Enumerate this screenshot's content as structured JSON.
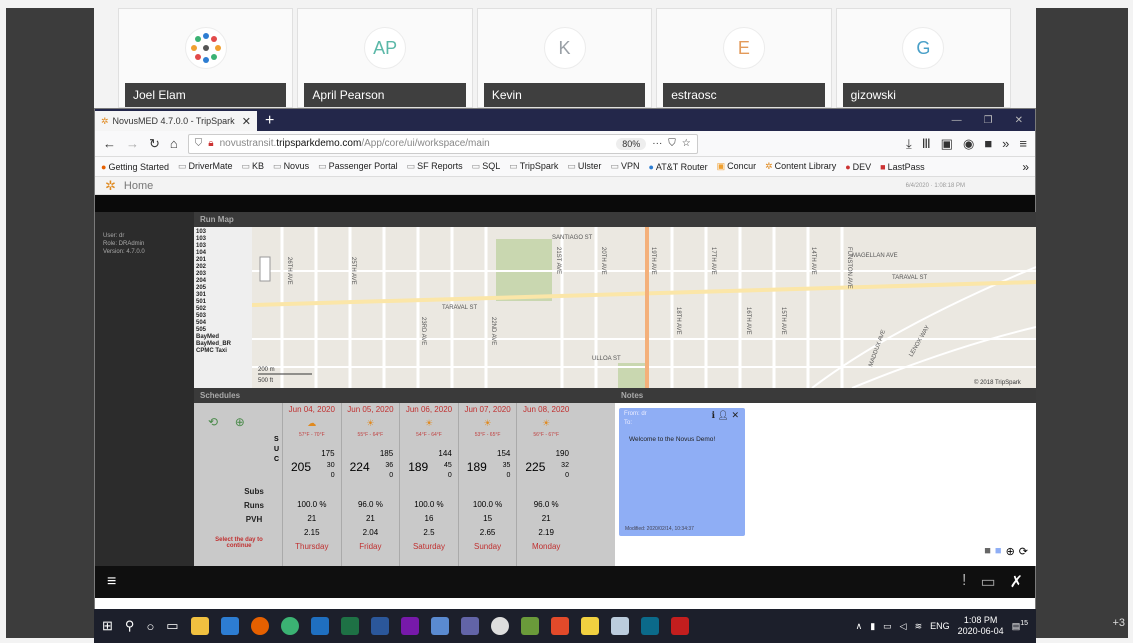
{
  "participants": [
    {
      "name": "Joel Elam",
      "initials": ""
    },
    {
      "name": "April Pearson",
      "initials": "AP",
      "color": "#5bb8a8"
    },
    {
      "name": "Kevin",
      "initials": "K",
      "color": "#9aa0a6"
    },
    {
      "name": "estraosc",
      "initials": "E",
      "color": "#e39a5a"
    },
    {
      "name": "gizowski",
      "initials": "G",
      "color": "#4aa0c8"
    }
  ],
  "extra_participants": "+3",
  "browser": {
    "tab_title": "NovusMED 4.7.0.0 - TripSpark",
    "url_prefix": "novustransit.",
    "url_domain": "tripsparkdemo.com",
    "url_path": "/App/core/ui/workspace/main",
    "zoom": "80%",
    "bookmarks": [
      "Getting Started",
      "DriverMate",
      "KB",
      "Novus",
      "Passenger Portal",
      "SF Reports",
      "SQL",
      "TripSpark",
      "Ulster",
      "VPN",
      "AT&T Router",
      "Concur",
      "Content Library",
      "DEV",
      "LastPass"
    ]
  },
  "app": {
    "home_label": "Home",
    "header_datetime": "6/4/2020 · 1:08:18 PM",
    "user_info": {
      "user": "User:   dr",
      "role": "Role:   DRAdmin",
      "version": "Version:  4.7.0.0"
    },
    "run_map": {
      "title": "Run Map",
      "runs": [
        "103",
        "103",
        "103",
        "104",
        "201",
        "202",
        "203",
        "204",
        "205",
        "301",
        "501",
        "502",
        "503",
        "504",
        "505",
        "BayMed",
        "BayMed_BR",
        "CPMC Taxi"
      ],
      "streets": [
        "SANTIAGO ST",
        "TARAVAL ST",
        "ULLOA ST",
        "MAGELLAN AVE",
        "TARAVAL ST",
        "26TH AVE",
        "25TH AVE",
        "23RD AVE",
        "22ND AVE",
        "21ST AVE",
        "20TH AVE",
        "19TH AVE",
        "18TH AVE",
        "17TH AVE",
        "16TH AVE",
        "15TH AVE",
        "14TH AVE",
        "FUNSTON AVE",
        "LENOX WAY",
        "MADDUX AVE"
      ],
      "scale_m": "200 m",
      "scale_ft": "500 ft",
      "attribution": "© 2018 TripSpark"
    },
    "schedules": {
      "title": "Schedules",
      "select_hint": "Select the day to continue",
      "row_labels": {
        "subs": "Subs",
        "runs": "Runs",
        "pvh": "PVH"
      },
      "suc_labels": [
        "S",
        "U",
        "C"
      ],
      "days": [
        {
          "date": "Jun 04, 2020",
          "temp": "57°F - 70°F",
          "s": "175",
          "total": "205",
          "u": "30",
          "c": "0",
          "subs": "100.0  %",
          "runs": "21",
          "pvh": "2.15",
          "dow": "Thursday"
        },
        {
          "date": "Jun 05, 2020",
          "temp": "55°F - 64°F",
          "s": "185",
          "total": "224",
          "u": "36",
          "c": "0",
          "subs": "96.0  %",
          "runs": "21",
          "pvh": "2.04",
          "dow": "Friday"
        },
        {
          "date": "Jun 06, 2020",
          "temp": "54°F - 64°F",
          "s": "144",
          "total": "189",
          "u": "45",
          "c": "0",
          "subs": "100.0  %",
          "runs": "16",
          "pvh": "2.5",
          "dow": "Saturday"
        },
        {
          "date": "Jun 07, 2020",
          "temp": "53°F - 65°F",
          "s": "154",
          "total": "189",
          "u": "35",
          "c": "0",
          "subs": "100.0  %",
          "runs": "15",
          "pvh": "2.65",
          "dow": "Sunday"
        },
        {
          "date": "Jun 08, 2020",
          "temp": "56°F - 67°F",
          "s": "190",
          "total": "225",
          "u": "32",
          "c": "0",
          "subs": "96.0  %",
          "runs": "21",
          "pvh": "2.19",
          "dow": "Monday"
        }
      ]
    },
    "notes": {
      "title": "Notes",
      "from": "From: dr",
      "to": "To:",
      "message": "Welcome to the Novus Demo!",
      "modified": "Modified: 2020/02/14, 10:34:37"
    }
  },
  "taskbar": {
    "lang": "ENG",
    "time": "1:08 PM",
    "date": "2020-06-04",
    "notifications": "15"
  }
}
